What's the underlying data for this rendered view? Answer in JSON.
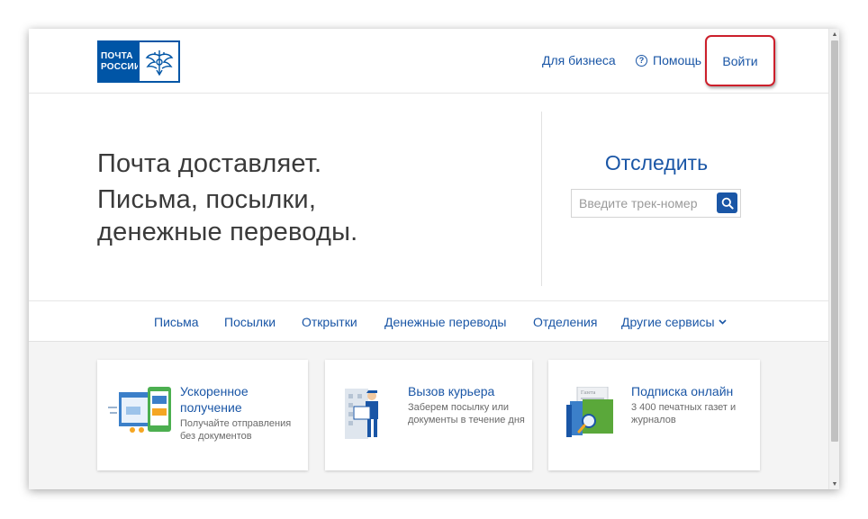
{
  "header": {
    "logo_line1": "ПОЧТА",
    "logo_line2": "РОССИИ",
    "nav_business": "Для бизнеса",
    "nav_help": "Помощь",
    "nav_login": "Войти"
  },
  "hero": {
    "line1": "Почта доставляет.",
    "line2": "Письма, посылки,",
    "line3": "денежные переводы."
  },
  "tracking": {
    "title": "Отследить",
    "placeholder": "Введите трек-номер"
  },
  "menu": {
    "items": [
      "Письма",
      "Посылки",
      "Открытки",
      "Денежные переводы",
      "Отделения",
      "Другие сервисы"
    ]
  },
  "cards": [
    {
      "title": "Ускоренное получение",
      "desc": "Получайте отправления без документов"
    },
    {
      "title": "Вызов курьера",
      "desc": "Заберем посылку или документы в течение дня"
    },
    {
      "title": "Подписка онлайн",
      "desc": "3 400 печатных газет и журналов",
      "newspaper_label": "Газета"
    }
  ],
  "colors": {
    "brand_blue": "#0055a6",
    "link_blue": "#1a56a6",
    "highlight_red": "#cc1f2b"
  }
}
